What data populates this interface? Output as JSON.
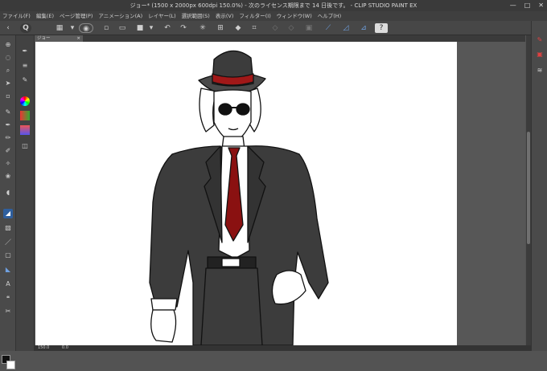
{
  "window": {
    "title": "ジョー* (1500 x 2000px 600dpi 150.0%) - 次のライセンス期限まで 14 日後です。 - CLIP STUDIO PAINT EX",
    "minimize": "—",
    "maximize": "□",
    "close": "✕"
  },
  "menu": [
    "ファイル(F)",
    "編集(E)",
    "ページ管理(P)",
    "アニメーション(A)",
    "レイヤー(L)",
    "選択範囲(S)",
    "表示(V)",
    "フィルター(I)",
    "ウィンドウ(W)",
    "ヘルプ(H)"
  ],
  "canvas_tab": {
    "label": "ジョー",
    "close": "×"
  },
  "status": {
    "zoom": "150.0",
    "angle": "0.0"
  },
  "colors": {
    "accent": "#2f5f9e",
    "tie": "#8a1111",
    "hatband": "#a11818",
    "suit": "#3c3c3c",
    "fg": "#111111",
    "bg": "#ffffff"
  }
}
